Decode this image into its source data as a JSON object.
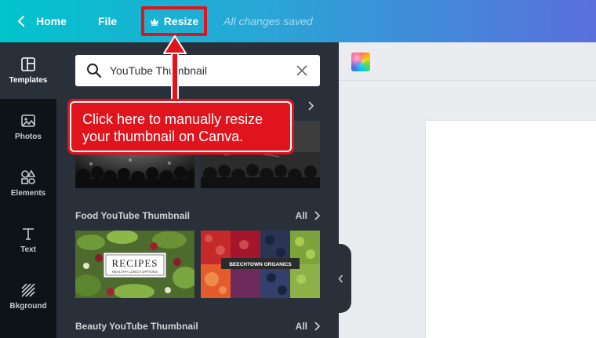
{
  "topbar": {
    "home_label": "Home",
    "file_label": "File",
    "resize_label": "Resize",
    "saved_status": "All changes saved"
  },
  "rail": {
    "items": [
      {
        "label": "Templates",
        "icon": "templates-icon",
        "active": true
      },
      {
        "label": "Photos",
        "icon": "photos-icon"
      },
      {
        "label": "Elements",
        "icon": "elements-icon"
      },
      {
        "label": "Text",
        "icon": "text-icon"
      },
      {
        "label": "Bkground",
        "icon": "background-icon"
      }
    ]
  },
  "panel": {
    "search_value": "YouTube Thumbnail",
    "sections": [
      {
        "title": "Food YouTube Thumbnail",
        "all_label": "All"
      },
      {
        "title": "Beauty YouTube Thumbnail",
        "all_label": "All"
      }
    ],
    "thumbnails": {
      "recipes_title": "RECIPES",
      "recipes_sub": "HEALTHY LUNCH OPTIONS",
      "organics_title": "BEECHTOWN ORGANICS"
    }
  },
  "callout": {
    "text": "Click here to manually resize your thumbnail on Canva."
  },
  "colors": {
    "accent_red": "#e0141c",
    "panel_bg": "#293039",
    "rail_bg": "#0e1318"
  }
}
